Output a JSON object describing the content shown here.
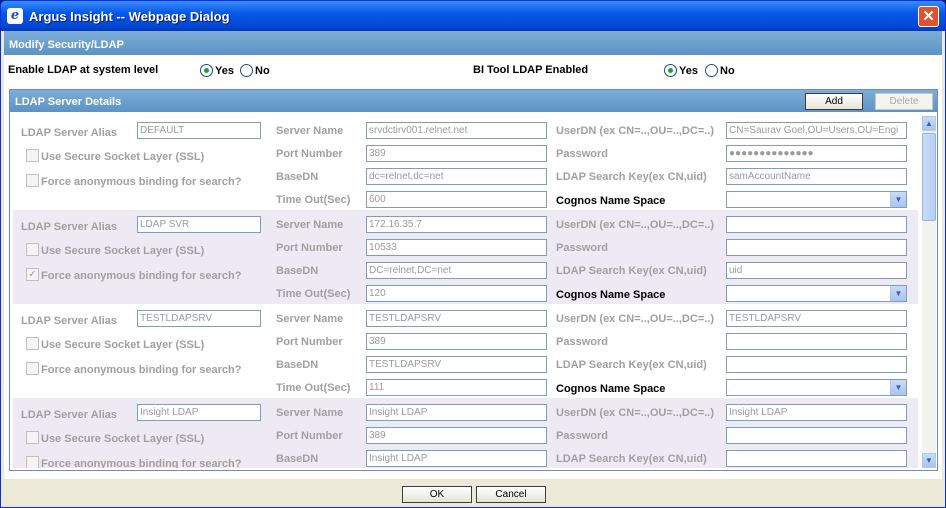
{
  "window": {
    "title": "Argus Insight -- Webpage Dialog",
    "icon": "ie-icon"
  },
  "section_title": "Modify Security/LDAP",
  "enable_ldap": {
    "label": "Enable LDAP at system level",
    "yes": "Yes",
    "no": "No",
    "selected": "Yes"
  },
  "bi_tool": {
    "label": "BI Tool LDAP Enabled",
    "yes": "Yes",
    "no": "No",
    "selected": "Yes"
  },
  "ldap_details": {
    "title": "LDAP Server Details",
    "add": "Add",
    "delete": "Delete"
  },
  "labels": {
    "alias": "LDAP Server Alias",
    "ssl": "Use Secure Socket Layer (SSL)",
    "anon": "Force anonymous binding for search?",
    "server": "Server Name",
    "port": "Port Number",
    "basedn": "BaseDN",
    "timeout": "Time Out(Sec)",
    "userdn": "UserDN (ex CN=..,OU=..,DC=..)",
    "password": "Password",
    "searchkey": "LDAP Search Key(ex CN,uid)",
    "cognos": "Cognos Name Space"
  },
  "servers": [
    {
      "alias": "DEFAULT",
      "server": "srvdctirv001.relnet.net",
      "port": "389",
      "basedn": "dc=relnet,dc=net",
      "timeout": "600",
      "userdn": "CN=Saurav Goel,OU=Users,OU=Engi",
      "password": "●●●●●●●●●●●●●●",
      "searchkey": "samAccountName",
      "ssl": false,
      "anon": false
    },
    {
      "alias": "LDAP SVR",
      "server": "172.16.35.7",
      "port": "10533",
      "basedn": "DC=relnet,DC=net",
      "timeout": "120",
      "userdn": "",
      "password": "",
      "searchkey": "uid",
      "ssl": false,
      "anon": true
    },
    {
      "alias": "TESTLDAPSRV",
      "server": "TESTLDAPSRV",
      "port": "389",
      "basedn": "TESTLDAPSRV",
      "timeout": "111",
      "userdn": "TESTLDAPSRV",
      "password": "",
      "searchkey": "",
      "ssl": false,
      "anon": false
    },
    {
      "alias": "Insight LDAP",
      "server": "Insight LDAP",
      "port": "389",
      "basedn": "Insight LDAP",
      "timeout": "",
      "userdn": "Insight LDAP",
      "password": "",
      "searchkey": "",
      "ssl": false,
      "anon": false
    }
  ],
  "footer": {
    "ok": "OK",
    "cancel": "Cancel"
  }
}
